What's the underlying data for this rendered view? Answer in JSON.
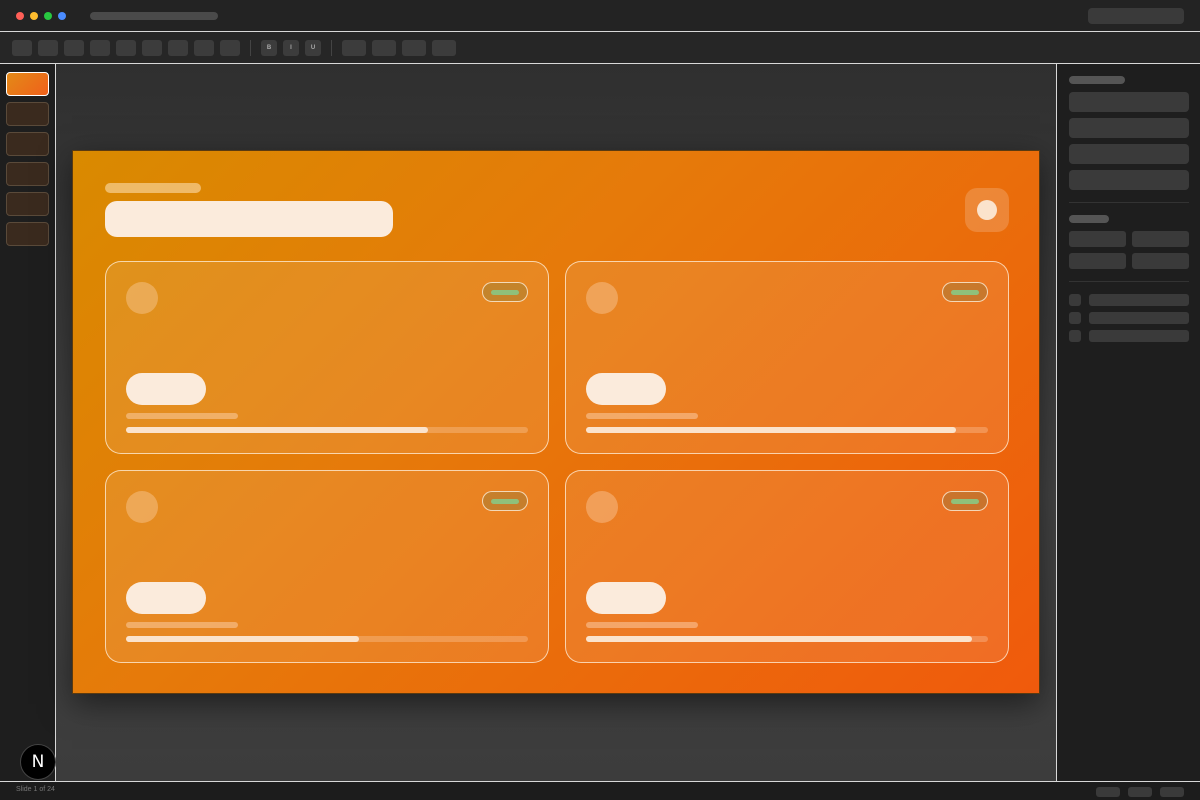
{
  "window": {
    "traffic_lights": [
      "#ff5f57",
      "#febc2e",
      "#28c840",
      "#4a8cff"
    ]
  },
  "toolbar": {
    "format_buttons": [
      "B",
      "I",
      "U"
    ]
  },
  "slides_panel": {
    "count_visible": 6,
    "active_index": 0
  },
  "slide": {
    "cards": [
      {
        "progress": 0.75,
        "status_color": "#8fc07a"
      },
      {
        "progress": 0.92,
        "status_color": "#8fc07a"
      },
      {
        "progress": 0.58,
        "status_color": "#8fc07a"
      },
      {
        "progress": 0.96,
        "status_color": "#8fc07a"
      }
    ],
    "gradient": [
      "#d98a00",
      "#f05a0c"
    ]
  },
  "statusbar": {
    "slide_indicator": "Slide 1 of 24"
  },
  "logo": {
    "glyph": "N"
  }
}
